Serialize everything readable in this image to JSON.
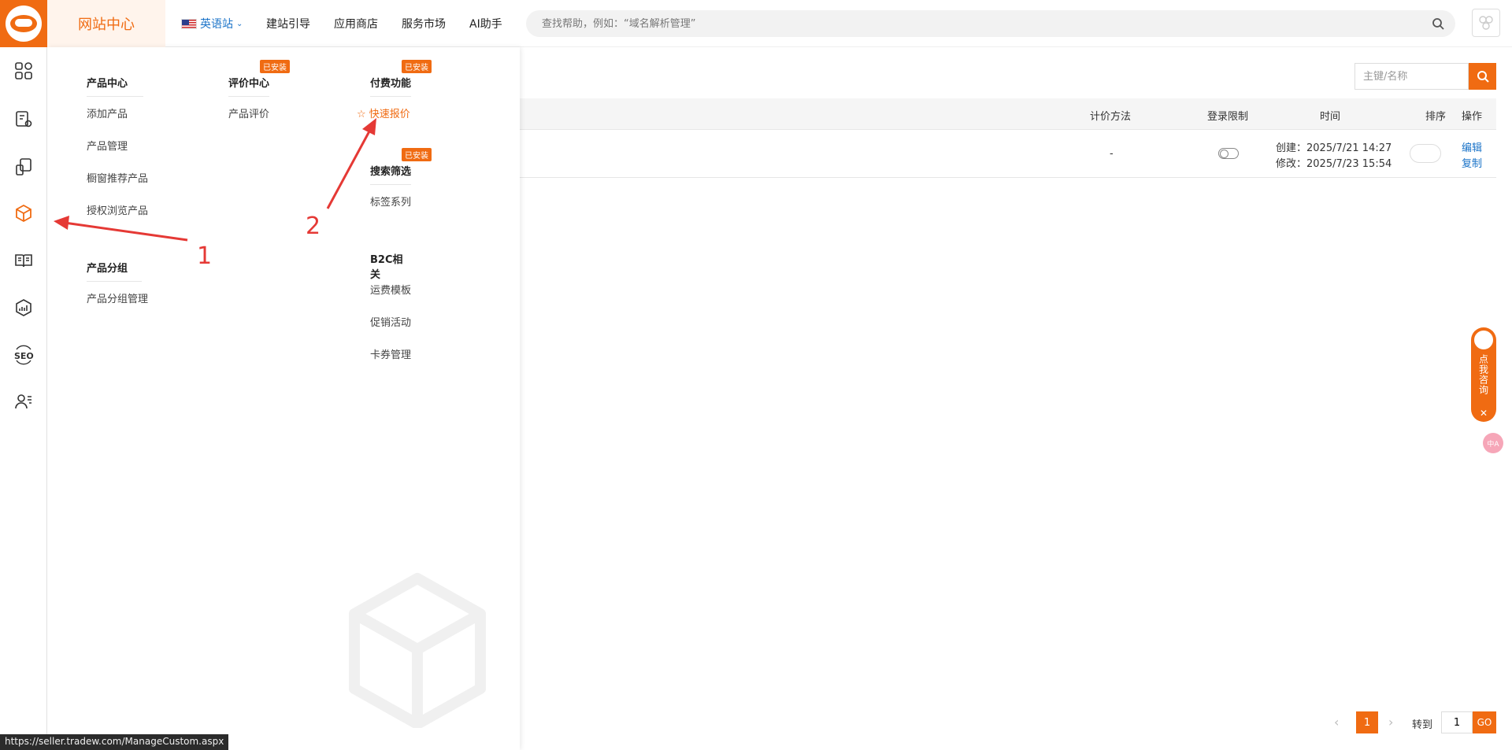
{
  "header": {
    "brand": "网站中心",
    "site": "英语站",
    "nav": [
      "建站引导",
      "应用商店",
      "服务市场",
      "AI助手"
    ],
    "search_placeholder": "查找帮助，例如：“域名解析管理”"
  },
  "menu": {
    "product_center": {
      "title": "产品中心",
      "items": [
        "添加产品",
        "产品管理",
        "橱窗推荐产品",
        "授权浏览产品"
      ]
    },
    "product_group": {
      "title": "产品分组",
      "items": [
        "产品分组管理"
      ]
    },
    "review_center": {
      "title": "评价中心",
      "badge": "已安装",
      "items": [
        "产品评价"
      ]
    },
    "paid_features": {
      "title": "付费功能",
      "badge": "已安装",
      "items": [
        "快速报价"
      ]
    },
    "search_filter": {
      "title": "搜索筛选",
      "badge": "已安装",
      "items": [
        "标签系列"
      ]
    },
    "b2c": {
      "title": "B2C相关",
      "items": [
        "运费模板",
        "促销活动",
        "卡券管理"
      ]
    }
  },
  "annotations": {
    "one": "1",
    "two": "2"
  },
  "toolbar": {
    "filter_placeholder": "主键/名称"
  },
  "table": {
    "headers": [
      "计价方法",
      "登录限制",
      "时间",
      "排序",
      "操作"
    ],
    "rows": [
      {
        "pricing": "-",
        "created": "创建：2025/7/21 14:27",
        "modified": "修改：2025/7/23 15:54",
        "actions": [
          "编辑",
          "复制"
        ]
      }
    ]
  },
  "pagination": {
    "current": "1",
    "goto_label": "转到",
    "goto_value": "1",
    "go": "GO"
  },
  "consult": {
    "label": "点我咨询",
    "close": "✕"
  },
  "translate": "中A",
  "status_url": "https://seller.tradew.com/ManageCustom.aspx",
  "colors": {
    "accent": "#f06b12",
    "link": "#1a73c8",
    "annotation": "#e53935"
  }
}
